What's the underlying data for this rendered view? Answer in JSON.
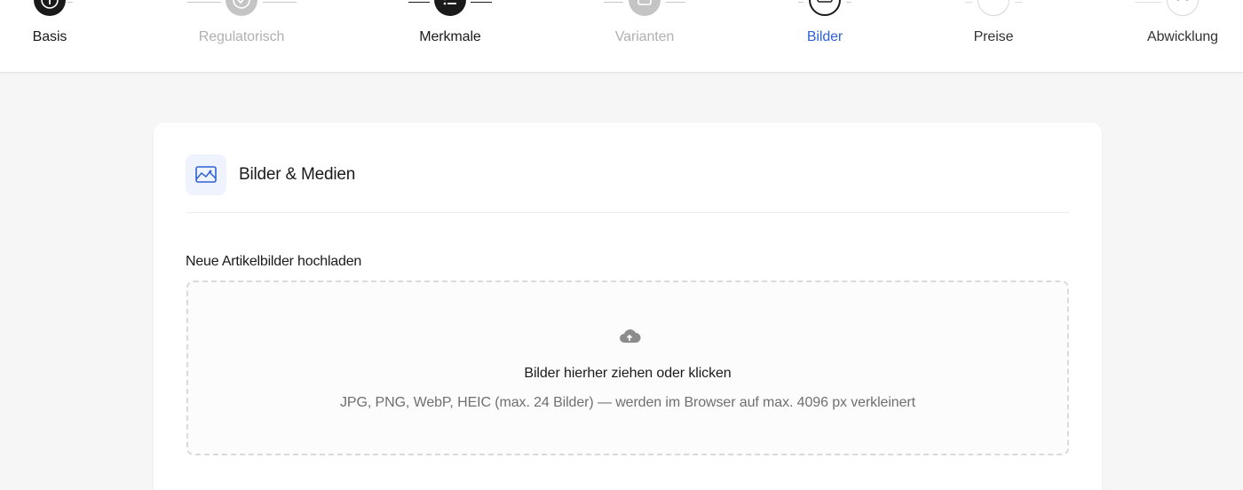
{
  "stepper": {
    "steps": [
      {
        "label": "Basis",
        "icon": "info-icon",
        "state": "completed"
      },
      {
        "label": "Regulatorisch",
        "icon": "check-shield-icon",
        "state": "disabled"
      },
      {
        "label": "Merkmale",
        "icon": "list-icon",
        "state": "completed"
      },
      {
        "label": "Varianten",
        "icon": "variants-icon",
        "state": "disabled"
      },
      {
        "label": "Bilder",
        "icon": "image-icon",
        "state": "active"
      },
      {
        "label": "Preise",
        "icon": "price-icon",
        "state": "upcoming"
      },
      {
        "label": "Abwicklung",
        "icon": "truck-icon",
        "state": "upcoming"
      }
    ],
    "colors": {
      "active": "#2f62d6",
      "completed": "#1a1a1a",
      "disabled": "#b0b0b0"
    }
  },
  "card": {
    "title": "Bilder & Medien",
    "icon": "image-icon",
    "upload_label": "Neue Artikelbilder hochladen",
    "dropzone": {
      "icon": "cloud-upload-icon",
      "title": "Bilder hierher ziehen oder klicken",
      "hint": "JPG, PNG, WebP, HEIC (max. 24 Bilder) — werden im Browser auf max. 4096 px verkleinert"
    }
  }
}
